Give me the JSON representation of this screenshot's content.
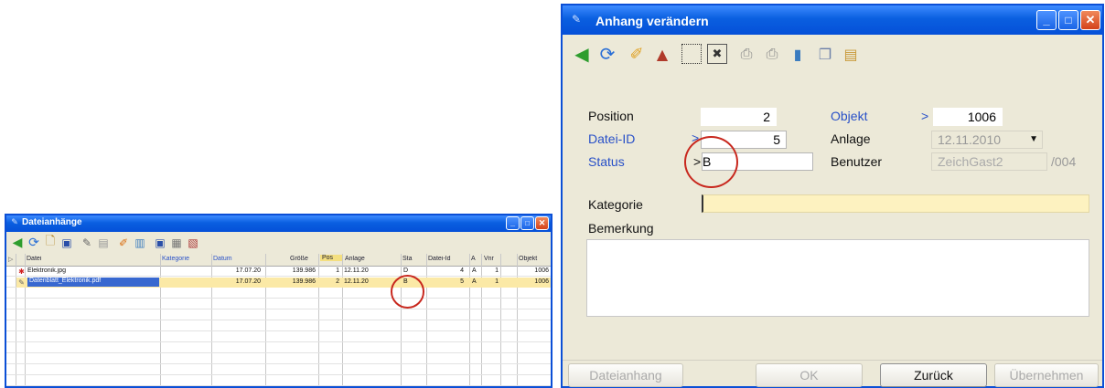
{
  "small_window": {
    "title": "Dateianhänge",
    "columns": [
      "Datei",
      "Kategorie",
      "Datum",
      "Größe",
      "Pos",
      "Anlage",
      "Sta",
      "Datei-Id",
      "A",
      "Vnr",
      "Objekt"
    ],
    "rows": [
      {
        "datei": "Elektronik.jpg",
        "kategorie": "",
        "datum": "17.07.20",
        "groesse": "139.986",
        "pos": "1",
        "anlage": "12.11.20",
        "status": "D",
        "datei_id": "4",
        "a": "A",
        "vnr": "1",
        "objekt": "1006"
      },
      {
        "datei": "Datenblatt_Elektronik.pdf",
        "kategorie": "",
        "datum": "17.07.20",
        "groesse": "139.986",
        "pos": "2",
        "anlage": "12.11.20",
        "status": "B",
        "datei_id": "5",
        "a": "A",
        "vnr": "1",
        "objekt": "1006"
      }
    ]
  },
  "main_window": {
    "title": "Anhang verändern",
    "labels": {
      "position": "Position",
      "objekt": "Objekt",
      "datei_id": "Datei-ID",
      "anlage": "Anlage",
      "status": "Status",
      "benutzer": "Benutzer",
      "kategorie": "Kategorie",
      "bemerkung": "Bemerkung"
    },
    "markers": {
      "objekt": ">",
      "datei_id": ">",
      "status": ">"
    },
    "values": {
      "position": "2",
      "objekt": "1006",
      "datei_id": "5",
      "anlage": "12.11.2010",
      "status": "B",
      "benutzer": "ZeichGast2",
      "benutzer_suffix": "/004",
      "kategorie": "",
      "bemerkung": ""
    },
    "buttons": {
      "dateianhang": "Dateianhang",
      "ok": "OK",
      "zurueck": "Zurück",
      "uebernehmen": "Übernehmen"
    }
  },
  "colors": {
    "titlebar": "#0a5fe0",
    "window_bg": "#ece9d8",
    "label_blue": "#2850c8",
    "kategorie_bg": "#fdf2c0",
    "selected_row": "#fbe9a6",
    "circle": "#c8281e"
  }
}
